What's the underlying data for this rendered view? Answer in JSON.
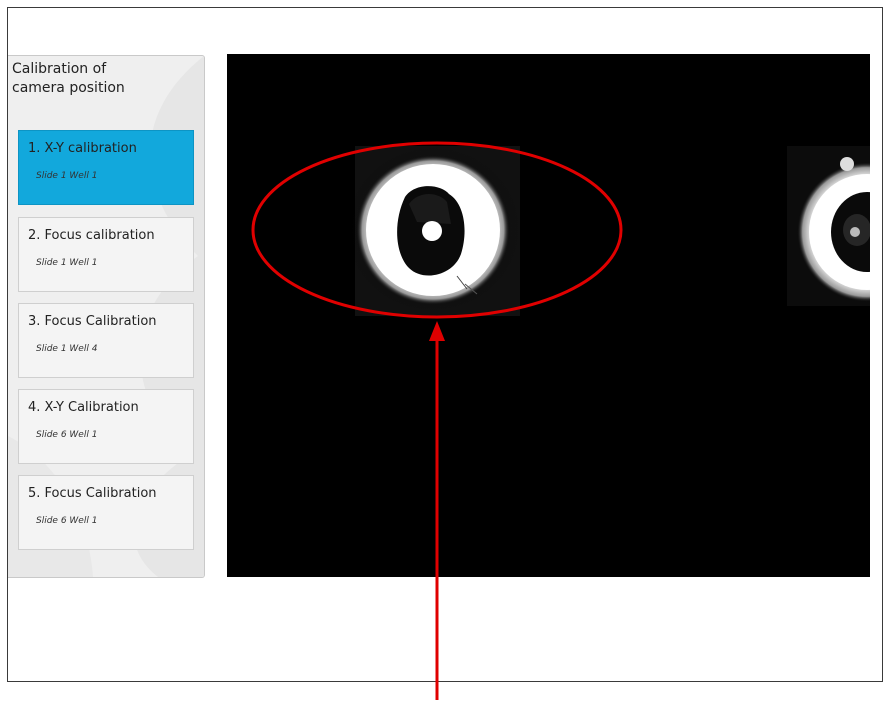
{
  "sidebar": {
    "title": "Calibration of\ncamera position",
    "steps": [
      {
        "label": "1. X-Y calibration",
        "sub": "Slide 1 Well 1",
        "active": true
      },
      {
        "label": "2. Focus calibration",
        "sub": "Slide 1 Well 1",
        "active": false
      },
      {
        "label": "3. Focus Calibration",
        "sub": "Slide 1 Well 4",
        "active": false
      },
      {
        "label": "4. X-Y Calibration",
        "sub": "Slide 6 Well 1",
        "active": false
      },
      {
        "label": "5. Focus Calibration",
        "sub": "Slide 6 Well 1",
        "active": false
      }
    ]
  },
  "colors": {
    "active_step": "#12a8dc",
    "annotation": "#e00000",
    "viewer_background": "#000000"
  },
  "icons": {
    "annotation": "red-ellipse-with-arrow"
  }
}
